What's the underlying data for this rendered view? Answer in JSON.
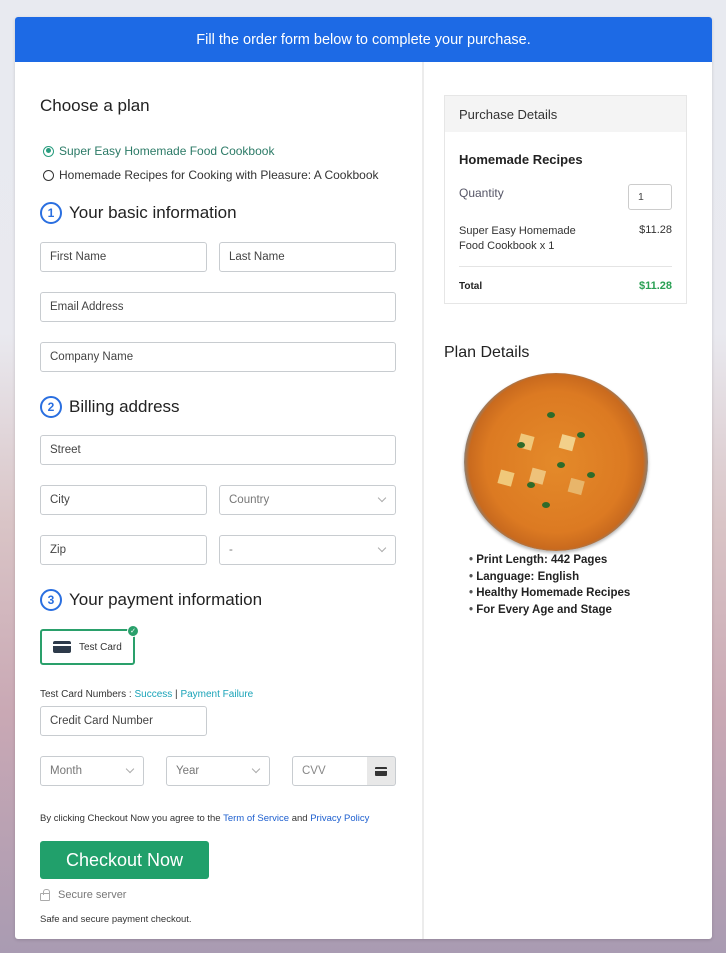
{
  "banner": {
    "text": "Fill the order form below to complete your purchase."
  },
  "plan": {
    "title": "Choose a plan",
    "options": [
      {
        "label": "Super Easy Homemade Food Cookbook",
        "selected": true
      },
      {
        "label": "Homemade Recipes for Cooking with Pleasure: A Cookbook",
        "selected": false
      }
    ]
  },
  "basic": {
    "number": "1",
    "title": "Your basic information",
    "first_name": "First Name",
    "last_name": "Last Name",
    "email": "Email Address",
    "company": "Company Name"
  },
  "billing": {
    "number": "2",
    "title": "Billing address",
    "street": "Street",
    "city": "City",
    "country": "Country",
    "zip": "Zip",
    "state": "-"
  },
  "payment": {
    "number": "3",
    "title": "Your payment information",
    "method_label": "Test Card",
    "test_numbers_label": "Test Card Numbers : ",
    "success_link": "Success",
    "separator": " | ",
    "failure_link": "Payment Failure",
    "card_number": "Credit Card Number",
    "month": "Month",
    "year": "Year",
    "cvv": "CVV"
  },
  "agreement": {
    "prefix": "By clicking Checkout Now you agree to the ",
    "tos": "Term of Service",
    "and": " and ",
    "privacy": "Privacy Policy"
  },
  "checkout": {
    "label": "Checkout Now"
  },
  "secure": {
    "label": "Secure server",
    "note": "Safe and secure payment checkout."
  },
  "purchase": {
    "header": "Purchase Details",
    "product": "Homemade Recipes",
    "quantity_label": "Quantity",
    "quantity": "1",
    "item": "Super Easy Homemade Food Cookbook x 1",
    "item_price": "$11.28",
    "total_label": "Total",
    "total": "$11.28"
  },
  "plan_details": {
    "title": "Plan Details",
    "features": [
      "Print Length: 442 Pages",
      "Language: English",
      "Healthy Homemade Recipes",
      "For Every Age and Stage"
    ]
  },
  "colors": {
    "banner": "#1d6ae5",
    "accent_green": "#21a06b",
    "total_green": "#2aa054",
    "link_teal": "#1aa3b8",
    "link_blue": "#1d5fcf"
  }
}
